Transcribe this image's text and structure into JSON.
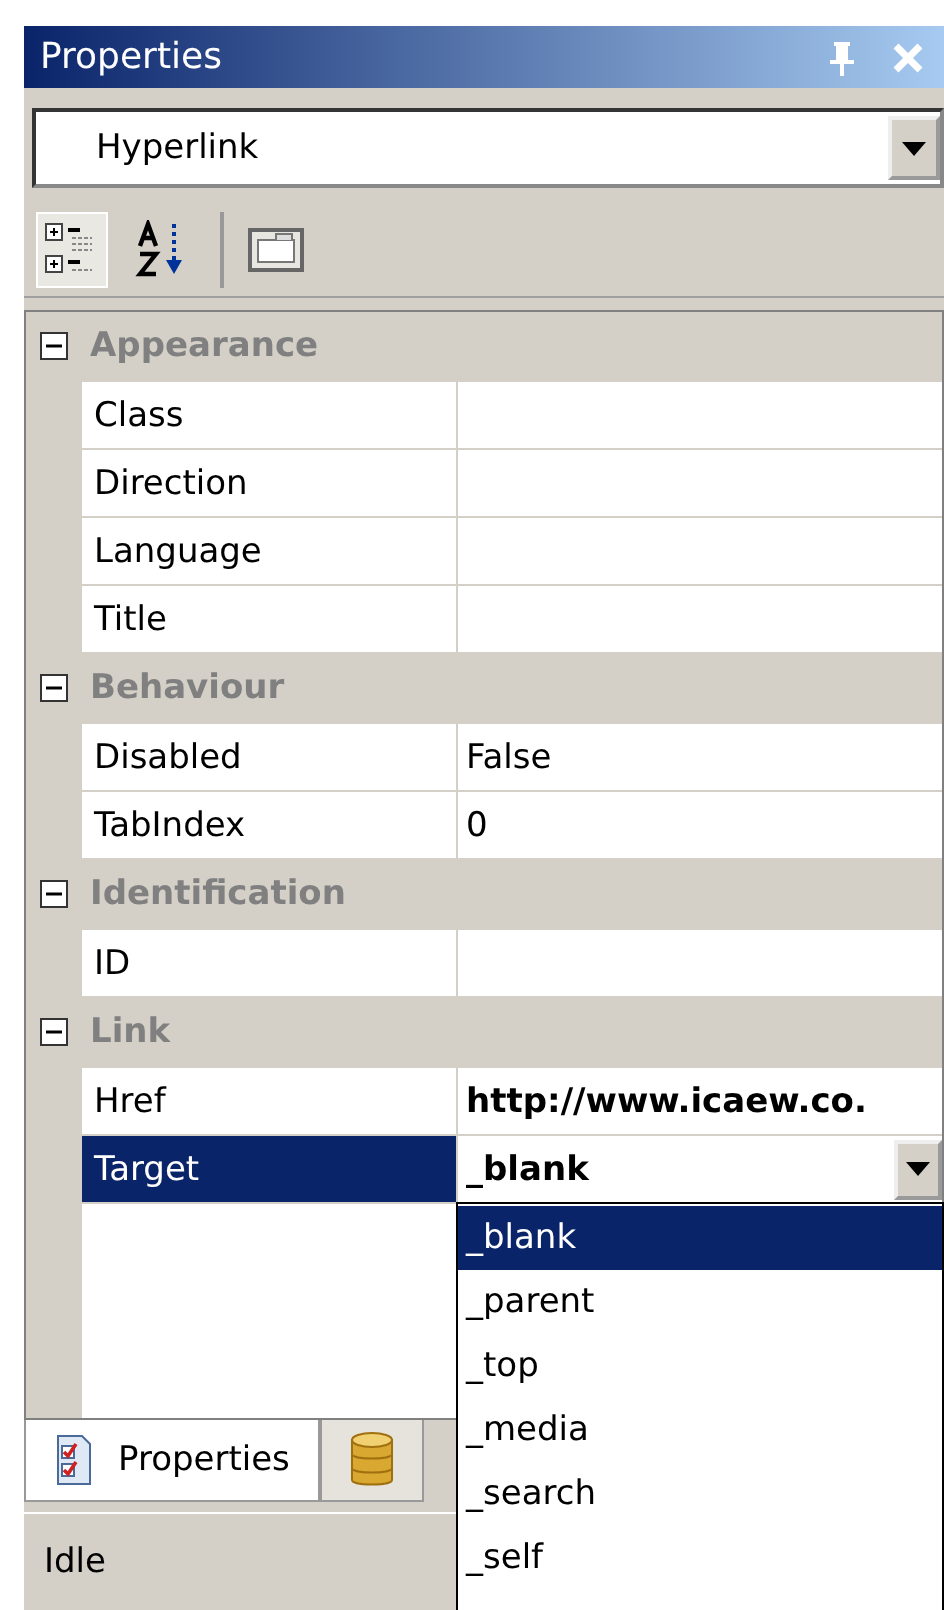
{
  "window": {
    "title": "Properties"
  },
  "object_selector": {
    "value": "Hyperlink"
  },
  "toolbar": [
    {
      "selected": true
    },
    {
      "selected": false
    },
    {
      "selected": false
    }
  ],
  "categories": [
    {
      "name": "Appearance",
      "expanded": true,
      "properties": [
        {
          "name": "Class",
          "selected": false
        },
        {
          "name": "Direction",
          "selected": false
        },
        {
          "name": "Language",
          "selected": false
        },
        {
          "name": "Title",
          "selected": false
        }
      ]
    },
    {
      "name": "Behaviour",
      "expanded": true,
      "properties": [
        {
          "name": "Disabled",
          "value": "False",
          "modified": false,
          "selected": false
        },
        {
          "name": "TabIndex",
          "value": "0",
          "modified": false,
          "selected": false
        }
      ]
    },
    {
      "name": "Identification",
      "expanded": true,
      "properties": [
        {
          "name": "ID",
          "selected": false
        }
      ]
    },
    {
      "name": "Link",
      "expanded": true,
      "properties": [
        {
          "name": "Href",
          "value": "http://www.icaew.co.",
          "modified": true,
          "selected": false
        },
        {
          "name": "Target",
          "value": "_blank",
          "modified": true,
          "selected": true
        }
      ]
    }
  ],
  "dropdown_list": [
    {
      "label": "_blank",
      "selected": true
    },
    {
      "label": "_parent",
      "selected": false
    },
    {
      "label": "_top",
      "selected": false
    },
    {
      "label": "_media",
      "selected": false
    },
    {
      "label": "_search",
      "selected": false
    },
    {
      "label": "_self",
      "selected": false
    }
  ],
  "tabs": [
    {
      "label": "Properties",
      "selected": true
    },
    {
      "selected": false
    }
  ],
  "status_bar": "Idle"
}
